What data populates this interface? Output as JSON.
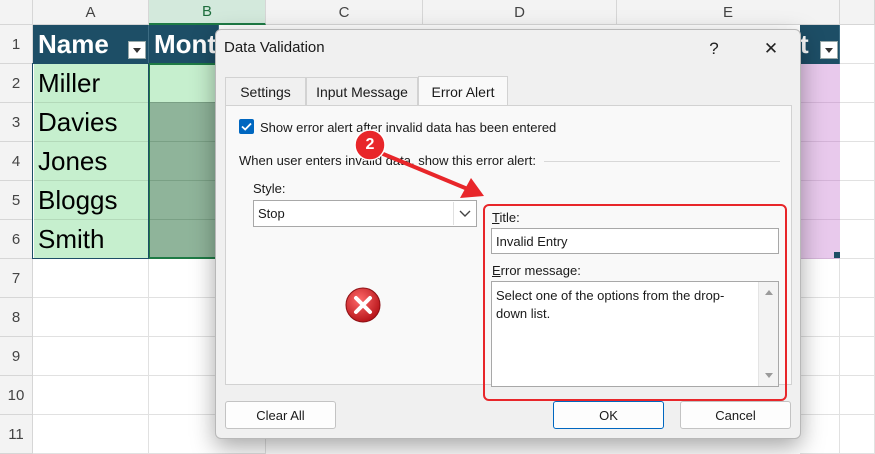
{
  "spreadsheet": {
    "columns": [
      "A",
      "B",
      "C",
      "D",
      "E"
    ],
    "rows": [
      "1",
      "2",
      "3",
      "4",
      "5",
      "6",
      "7",
      "8",
      "9",
      "10",
      "11"
    ],
    "header_cells": {
      "a1": "Name",
      "b1": "Mont",
      "e1_tail": "t"
    },
    "names": [
      "Miller",
      "Davies",
      "Jones",
      "Bloggs",
      "Smith"
    ]
  },
  "dialog": {
    "title": "Data Validation",
    "help_label": "?",
    "close_label": "✕",
    "tabs": [
      "Settings",
      "Input Message",
      "Error Alert"
    ],
    "active_tab": "Error Alert",
    "checkbox": {
      "checked": true,
      "label": "Show error alert after invalid data has been entered"
    },
    "group_label": "When user enters invalid data, show this error alert:",
    "style": {
      "label": "Style:",
      "value": "Stop"
    },
    "title_field": {
      "label": "Title:",
      "value": "Invalid Entry"
    },
    "message_field": {
      "label": "Error message:",
      "value": "Select one of the options from the drop-down list."
    },
    "buttons": {
      "clear_all": "Clear All",
      "ok": "OK",
      "cancel": "Cancel"
    }
  },
  "annotation": {
    "step_number": "2"
  },
  "colors": {
    "header_fill": "#1d4e66",
    "name_fill": "#c6efce",
    "highlight_red": "#e8262a",
    "error_icon": "#d9262b",
    "accent_blue": "#0067c0"
  },
  "icons": {
    "error_icon": "error-stop-icon",
    "dropdown": "chevron-down-icon",
    "filter": "filter-dropdown-icon"
  }
}
